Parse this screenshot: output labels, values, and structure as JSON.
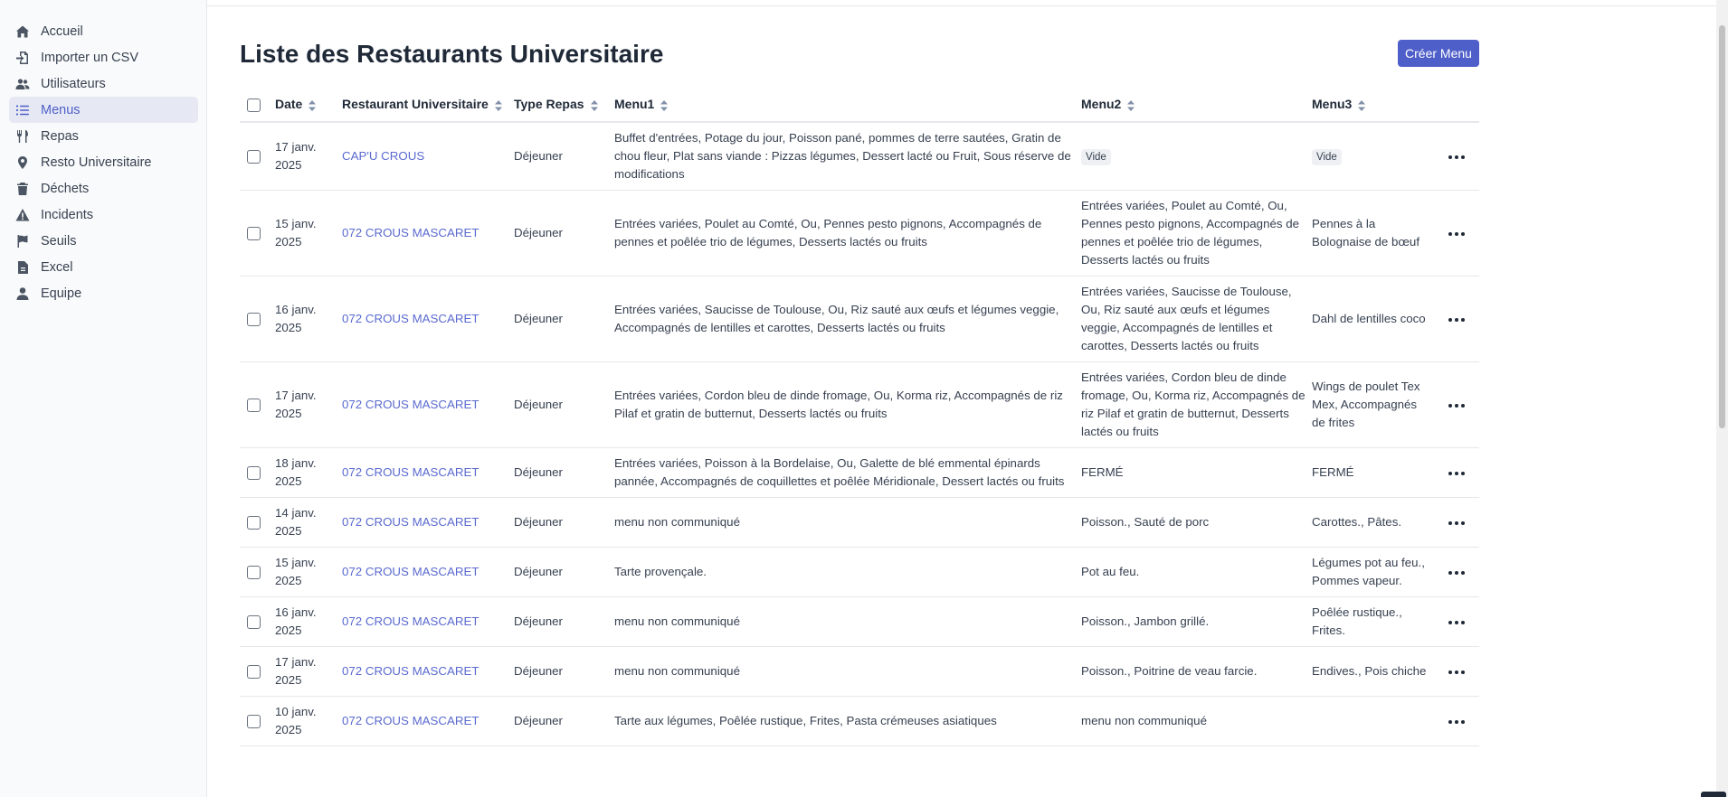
{
  "sidebar": {
    "items": [
      {
        "label": "Accueil",
        "icon": "home-icon",
        "active": false
      },
      {
        "label": "Importer un CSV",
        "icon": "import-icon",
        "active": false
      },
      {
        "label": "Utilisateurs",
        "icon": "users-icon",
        "active": false
      },
      {
        "label": "Menus",
        "icon": "list-icon",
        "active": true
      },
      {
        "label": "Repas",
        "icon": "utensils-icon",
        "active": false
      },
      {
        "label": "Resto Universitaire",
        "icon": "map-pin-icon",
        "active": false
      },
      {
        "label": "Déchets",
        "icon": "trash-icon",
        "active": false
      },
      {
        "label": "Incidents",
        "icon": "warning-icon",
        "active": false
      },
      {
        "label": "Seuils",
        "icon": "flag-icon",
        "active": false
      },
      {
        "label": "Excel",
        "icon": "file-icon",
        "active": false
      },
      {
        "label": "Equipe",
        "icon": "user-icon",
        "active": false
      }
    ]
  },
  "page": {
    "title": "Liste des Restaurants Universitaire",
    "create_button": "Créer Menu"
  },
  "table": {
    "headers": {
      "date": "Date",
      "resto": "Restaurant Universitaire",
      "type": "Type Repas",
      "menu1": "Menu1",
      "menu2": "Menu2",
      "menu3": "Menu3"
    },
    "rows": [
      {
        "date": "17 janv. 2025",
        "resto": "CAP'U CROUS",
        "type": "Déjeuner",
        "menu1": "Buffet d'entrées, Potage du jour, Poisson pané, pommes de terre sautées, Gratin de chou fleur, Plat sans viande : Pizzas légumes, Dessert lacté ou Fruit, Sous réserve de modifications",
        "menu2": "Vide",
        "menu3": "Vide",
        "menu2_badge": true,
        "menu3_badge": true
      },
      {
        "date": "15 janv. 2025",
        "resto": "072 CROUS MASCARET",
        "type": "Déjeuner",
        "menu1": "Entrées variées, Poulet au Comté, Ou, Pennes pesto pignons, Accompagnés de pennes et poêlée trio de légumes, Desserts lactés ou fruits",
        "menu2": "Entrées variées, Poulet au Comté, Ou, Pennes pesto pignons, Accompagnés de pennes et poêlée trio de légumes, Desserts lactés ou fruits",
        "menu3": "Pennes à la Bolognaise de bœuf"
      },
      {
        "date": "16 janv. 2025",
        "resto": "072 CROUS MASCARET",
        "type": "Déjeuner",
        "menu1": "Entrées variées, Saucisse de Toulouse, Ou, Riz sauté aux œufs et légumes veggie, Accompagnés de lentilles et carottes, Desserts lactés ou fruits",
        "menu2": "Entrées variées, Saucisse de Toulouse, Ou, Riz sauté aux œufs et légumes veggie, Accompagnés de lentilles et carottes, Desserts lactés ou fruits",
        "menu3": "Dahl de lentilles coco"
      },
      {
        "date": "17 janv. 2025",
        "resto": "072 CROUS MASCARET",
        "type": "Déjeuner",
        "menu1": "Entrées variées, Cordon bleu de dinde fromage, Ou, Korma riz, Accompagnés de riz Pilaf et gratin de butternut, Desserts lactés ou fruits",
        "menu2": "Entrées variées, Cordon bleu de dinde fromage, Ou, Korma riz, Accompagnés de riz Pilaf et gratin de butternut, Desserts lactés ou fruits",
        "menu3": "Wings de poulet Tex Mex, Accompagnés de frites"
      },
      {
        "date": "18 janv. 2025",
        "resto": "072 CROUS MASCARET",
        "type": "Déjeuner",
        "menu1": "Entrées variées, Poisson à la Bordelaise, Ou, Galette de blé emmental épinards pannée, Accompagnés de coquillettes et poêlée Méridionale, Dessert lactés ou fruits",
        "menu2": "FERMÉ",
        "menu3": "FERMÉ"
      },
      {
        "date": "14 janv. 2025",
        "resto": "072 CROUS MASCARET",
        "type": "Déjeuner",
        "menu1": "menu non communiqué",
        "menu2": "Poisson., Sauté de porc",
        "menu3": "Carottes., Pâtes."
      },
      {
        "date": "15 janv. 2025",
        "resto": "072 CROUS MASCARET",
        "type": "Déjeuner",
        "menu1": "Tarte provençale.",
        "menu2": "Pot au feu.",
        "menu3": "Légumes pot au feu., Pommes vapeur."
      },
      {
        "date": "16 janv. 2025",
        "resto": "072 CROUS MASCARET",
        "type": "Déjeuner",
        "menu1": "menu non communiqué",
        "menu2": "Poisson., Jambon grillé.",
        "menu3": "Poêlée rustique., Frites."
      },
      {
        "date": "17 janv. 2025",
        "resto": "072 CROUS MASCARET",
        "type": "Déjeuner",
        "menu1": "menu non communiqué",
        "menu2": "Poisson., Poitrine de veau farcie.",
        "menu3": "Endives., Pois chiche"
      },
      {
        "date": "10 janv. 2025",
        "resto": "072 CROUS MASCARET",
        "type": "Déjeuner",
        "menu1": "Tarte aux légumes, Poêlée rustique, Frites, Pasta crémeuses asiatiques",
        "menu2": "menu non communiqué",
        "menu3": ""
      }
    ]
  },
  "colors": {
    "accent": "#4f5fc9",
    "link": "#5a6acf",
    "active_bg": "#e6e9f3"
  }
}
